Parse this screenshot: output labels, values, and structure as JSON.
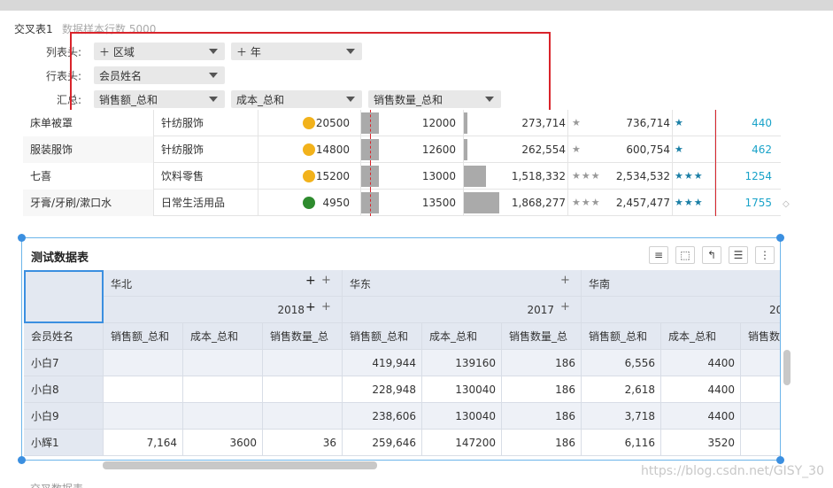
{
  "header": {
    "title": "交叉表1",
    "subtitle": "数据样本行数 5000"
  },
  "config": {
    "col_label": "列表头:",
    "row_label": "行表头:",
    "sum_label": "汇总:",
    "col_pills": [
      "＋ 区域",
      "＋ 年"
    ],
    "row_pills": [
      "会员姓名"
    ],
    "sum_pills": [
      "销售额_总和",
      "成本_总和",
      "销售数量_总和"
    ]
  },
  "upper_table": {
    "rows": [
      {
        "name": "床单被罩",
        "cat": "针纺服饰",
        "v1": "20500",
        "v2": "12000",
        "v3": "273,714",
        "v4": "736,714",
        "v5": "440",
        "dot": "#f2b21b",
        "bar": 0.04
      },
      {
        "name": "服装服饰",
        "cat": "针纺服饰",
        "v1": "14800",
        "v2": "12600",
        "v3": "262,554",
        "v4": "600,754",
        "v5": "462",
        "dot": "#f2b21b",
        "bar": 0.04
      },
      {
        "name": "七喜",
        "cat": "饮料零售",
        "v1": "15200",
        "v2": "13000",
        "v3": "1,518,332",
        "v4": "2,534,532",
        "v5": "1254",
        "dot": "#f2b21b",
        "bar": 0.25
      },
      {
        "name": "牙膏/牙刷/漱口水",
        "cat": "日常生活用品",
        "v1": "4950",
        "v2": "13500",
        "v3": "1,868,277",
        "v4": "2,457,477",
        "v5": "1755",
        "dot": "#2e8b2e",
        "bar": 0.4
      }
    ]
  },
  "widget": {
    "title": "测试数据表",
    "icons": [
      "database-icon",
      "select-icon",
      "undo-icon",
      "list-icon",
      "more-icon"
    ],
    "regions": [
      "华北",
      "华东",
      "华南"
    ],
    "years": [
      "2018",
      "2017",
      "20"
    ],
    "member_header": "会员姓名",
    "measures": [
      "销售额_总和",
      "成本_总和",
      "销售数量_总",
      "销售额_总和",
      "成本_总和",
      "销售数量_总",
      "销售额_总和",
      "成本_总和",
      "销售数"
    ],
    "rows": [
      {
        "name": "小白7",
        "cells": [
          "",
          "",
          "",
          "419,944",
          "139160",
          "186",
          "6,556",
          "4400",
          ""
        ]
      },
      {
        "name": "小白8",
        "cells": [
          "",
          "",
          "",
          "228,948",
          "130040",
          "186",
          "2,618",
          "4400",
          ""
        ]
      },
      {
        "name": "小白9",
        "cells": [
          "",
          "",
          "",
          "238,606",
          "130040",
          "186",
          "3,718",
          "4400",
          ""
        ]
      },
      {
        "name": "小辉1",
        "cells": [
          "7,164",
          "3600",
          "36",
          "259,646",
          "147200",
          "186",
          "6,116",
          "3520",
          ""
        ]
      }
    ]
  },
  "watermark": "https://blog.csdn.net/GISY_30",
  "bottom_title": "交叉数据表"
}
